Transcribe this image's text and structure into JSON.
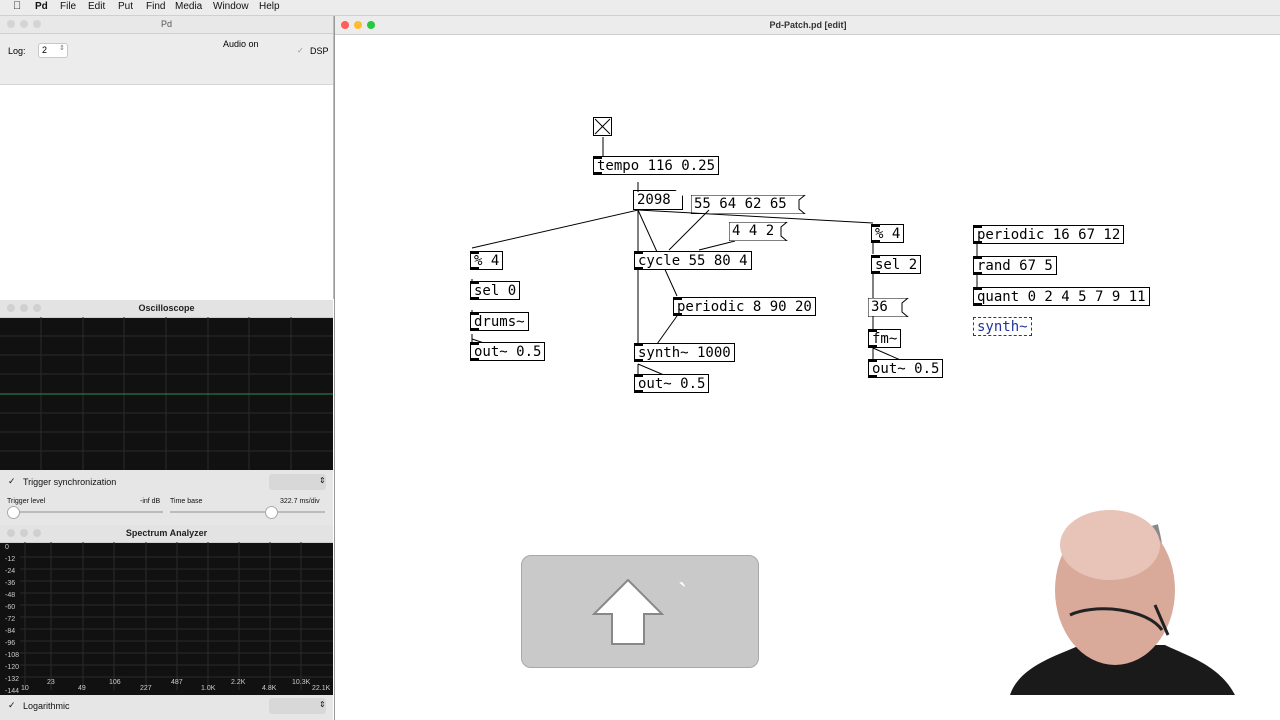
{
  "menubar": {
    "app": "Pd",
    "items": [
      "File",
      "Edit",
      "Put",
      "Find",
      "Media",
      "Window",
      "Help"
    ]
  },
  "pd_window": {
    "title": "Pd",
    "log_label": "Log:",
    "log_value": "2",
    "audio_status": "Audio on",
    "dsp_label": "DSP"
  },
  "oscilloscope": {
    "title": "Oscilloscope",
    "trigger_sync_label": "Trigger synchronization",
    "trigger_level_label": "Trigger level",
    "trigger_level_value": "-inf dB",
    "time_base_label": "Time base",
    "time_base_value": "322.7 ms/div",
    "trigger_level_fraction": 0.0,
    "time_base_fraction": 0.66
  },
  "spectrum": {
    "title": "Spectrum Analyzer",
    "db_ticks": [
      "0",
      "-12",
      "-24",
      "-36",
      "-48",
      "-60",
      "-72",
      "-84",
      "-96",
      "-108",
      "-120",
      "-132",
      "-144"
    ],
    "freq_ticks_top": [
      "23",
      "106",
      "487",
      "2.2K",
      "10.3K"
    ],
    "freq_ticks_bottom": [
      "10",
      "49",
      "227",
      "1.0K",
      "4.8K",
      "22.1K"
    ],
    "log_label": "Logarithmic"
  },
  "patch": {
    "title": "Pd-Patch.pd [edit]",
    "objects": {
      "tempo": "tempo 116 0.25",
      "num2098": "2098",
      "msg_notes": "55 64 62 65",
      "msg_442": "4 4 2",
      "mod4_left": "% 4",
      "sel0": "sel 0",
      "drums": "drums~",
      "out_left": "out~ 0.5",
      "cycle": "cycle 55 80 4",
      "periodic_mid": "periodic 8 90 20",
      "synth1000": "synth~ 1000",
      "out_mid": "out~ 0.5",
      "mod4_right": "% 4",
      "sel2": "sel 2",
      "msg36": "36",
      "fm": "fm~",
      "out_right": "out~ 0.5",
      "periodic_r": "periodic 16 67 12",
      "rand": "rand 67 5",
      "quant": "quant 0 2 4 5 7 9 11",
      "synth_edit": "synth~"
    }
  },
  "key_overlay": {
    "glyph": "`"
  }
}
